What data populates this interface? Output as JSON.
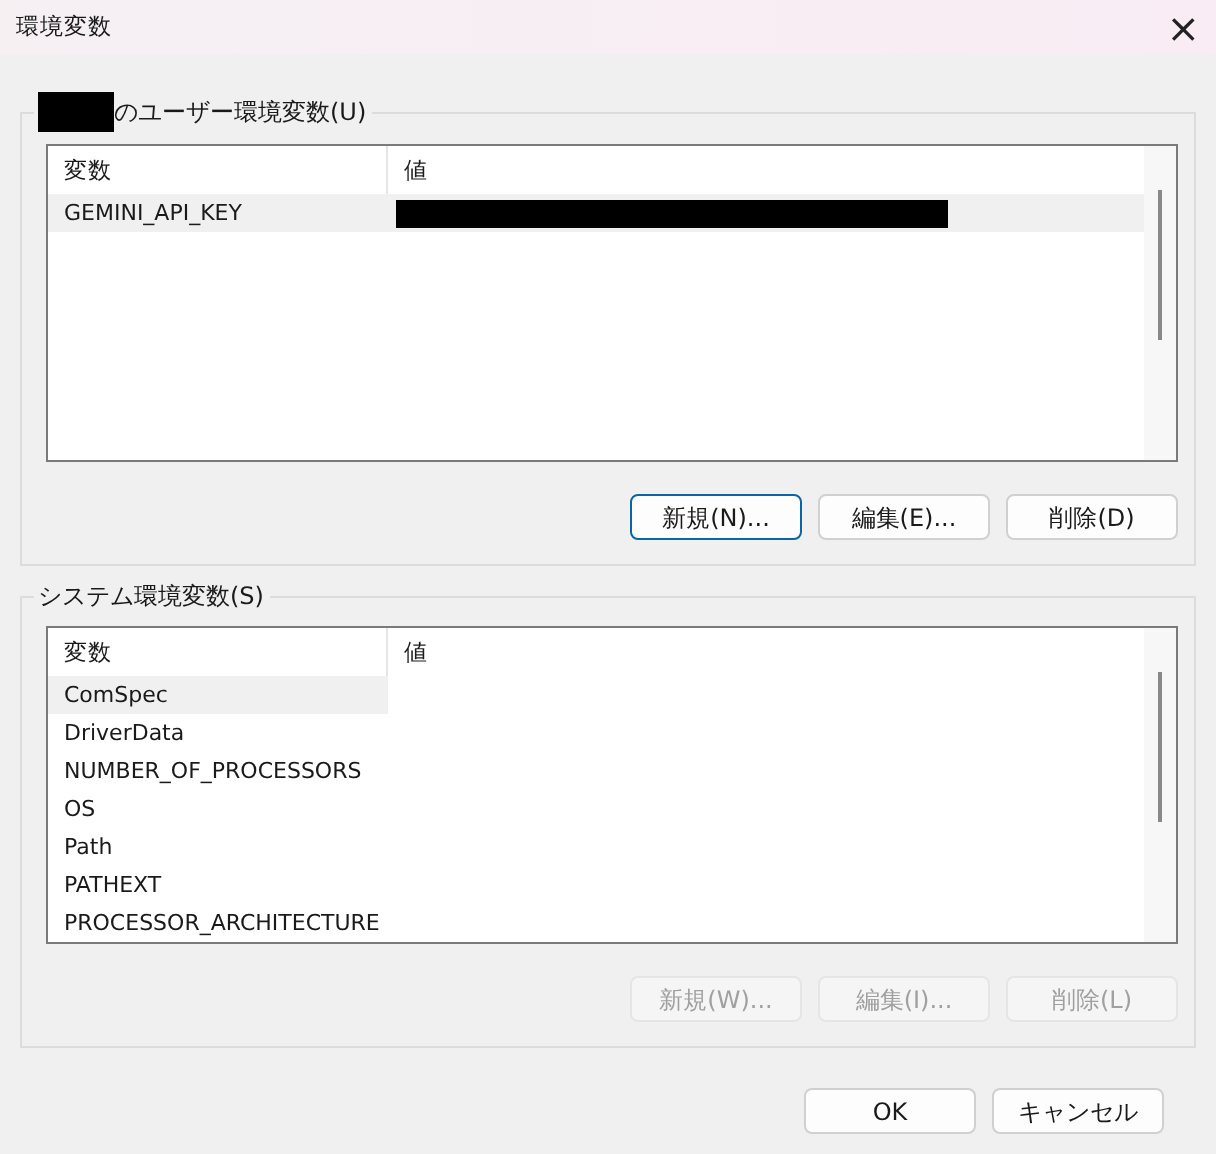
{
  "window": {
    "title": "環境変数",
    "close": "×"
  },
  "user_group": {
    "owner_redacted": true,
    "label": "のユーザー環境変数(U)",
    "full_row_select": true,
    "columns": [
      "変数",
      "値"
    ],
    "rows": [
      {
        "variable": "GEMINI_API_KEY",
        "value_redacted": true,
        "selected": true
      }
    ],
    "buttons": [
      {
        "label": "新規(N)...",
        "default": true,
        "disabled": false
      },
      {
        "label": "編集(E)...",
        "default": false,
        "disabled": false
      },
      {
        "label": "削除(D)",
        "default": false,
        "disabled": false
      }
    ]
  },
  "system_group": {
    "label": "システム環境変数(S)",
    "full_row_select": false,
    "columns": [
      "変数",
      "値"
    ],
    "rows": [
      {
        "variable": "ComSpec",
        "value_redacted": false,
        "selected": true
      },
      {
        "variable": "DriverData",
        "value_redacted": false,
        "selected": false
      },
      {
        "variable": "NUMBER_OF_PROCESSORS",
        "value_redacted": false,
        "selected": false
      },
      {
        "variable": "OS",
        "value_redacted": false,
        "selected": false
      },
      {
        "variable": "Path",
        "value_redacted": false,
        "selected": false
      },
      {
        "variable": "PATHEXT",
        "value_redacted": false,
        "selected": false
      },
      {
        "variable": "PROCESSOR_ARCHITECTURE",
        "value_redacted": false,
        "selected": false
      }
    ],
    "buttons": [
      {
        "label": "新規(W)...",
        "default": false,
        "disabled": true
      },
      {
        "label": "編集(I)...",
        "default": false,
        "disabled": true
      },
      {
        "label": "削除(L)",
        "default": false,
        "disabled": true
      }
    ]
  },
  "footer_buttons": [
    {
      "label": "OK",
      "default": false,
      "disabled": false
    },
    {
      "label": "キャンセル",
      "default": false,
      "disabled": false
    }
  ]
}
